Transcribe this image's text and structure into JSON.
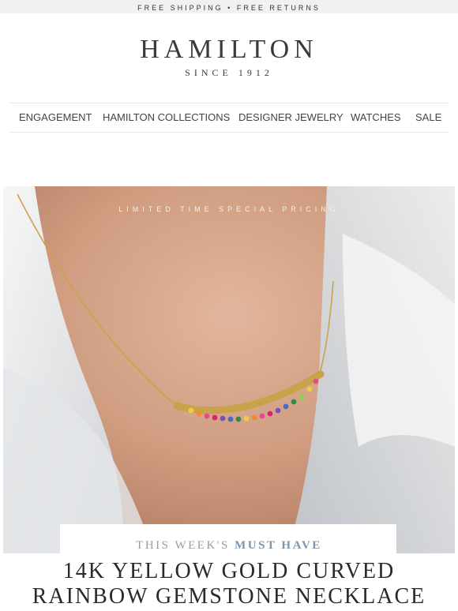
{
  "top_bar": {
    "text": "FREE SHIPPING  •  FREE RETURNS"
  },
  "header": {
    "brand": "HAMILTON",
    "tagline": "SINCE 1912"
  },
  "nav": {
    "items": [
      {
        "label": "ENGAGEMENT"
      },
      {
        "label": "HAMILTON COLLECTIONS"
      },
      {
        "label": "DESIGNER JEWELRY"
      },
      {
        "label": "WATCHES"
      },
      {
        "label": "SALE"
      }
    ]
  },
  "hero": {
    "promo": "LIMITED TIME SPECIAL PRICING",
    "kicker_plain": "THIS WEEK'S",
    "kicker_accent": "MUST HAVE",
    "product_line1": "14K YELLOW GOLD CURVED",
    "product_line2": "RAINBOW GEMSTONE NECKLACE"
  },
  "colors": {
    "accent": "#7c95ad",
    "top_bar_bg": "#f1f1f1",
    "text": "#3a3a3a"
  }
}
